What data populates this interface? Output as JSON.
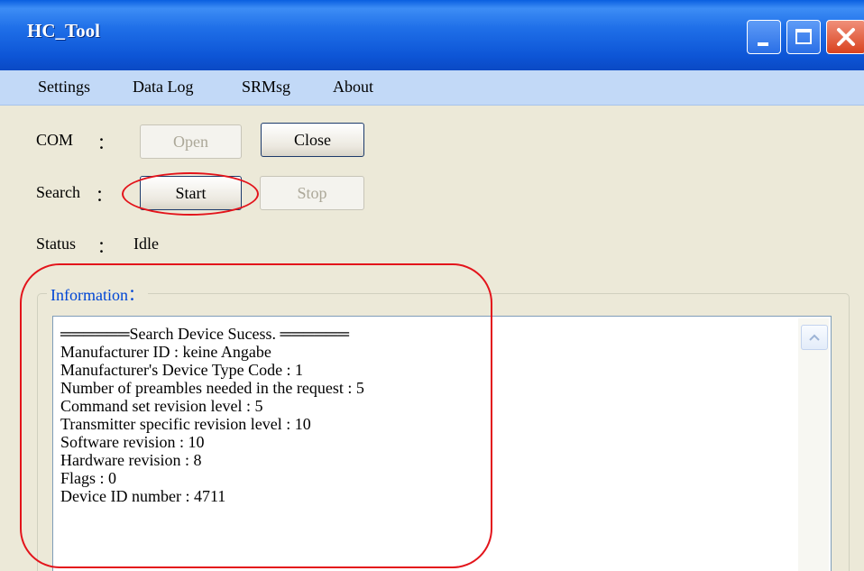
{
  "window": {
    "title": "HC_Tool"
  },
  "menu": {
    "items": [
      "Settings",
      "Data Log",
      "SRMsg",
      "About"
    ]
  },
  "com": {
    "label": "COM",
    "colon": "：",
    "open_label": "Open",
    "close_label": "Close"
  },
  "search": {
    "label": "Search",
    "colon": "：",
    "start_label": "Start",
    "stop_label": "Stop"
  },
  "status": {
    "label": "Status",
    "colon": "：",
    "value": "Idle"
  },
  "information": {
    "label": "Information",
    "colon": "：",
    "lines": [
      "══════Search Device Sucess. ══════",
      "Manufacturer ID : keine Angabe",
      "Manufacturer's Device Type Code : 1",
      "Number of preambles needed in the request : 5",
      "Command set revision level : 5",
      "Transmitter specific revision level : 10",
      "Software revision : 10",
      "Hardware revision : 8",
      "Flags : 0",
      "Device ID number : 4711"
    ]
  },
  "icons": {
    "minimize": "minimize-icon",
    "maximize": "maximize-icon",
    "close": "close-icon",
    "scroll_up": "scroll-up-arrow-icon"
  },
  "colors": {
    "titlebar": "#0a5fe0",
    "menubar": "#c2d9f7",
    "window_bg": "#ece9d8",
    "annotation": "#e3141b",
    "group_label": "#0046d5"
  }
}
